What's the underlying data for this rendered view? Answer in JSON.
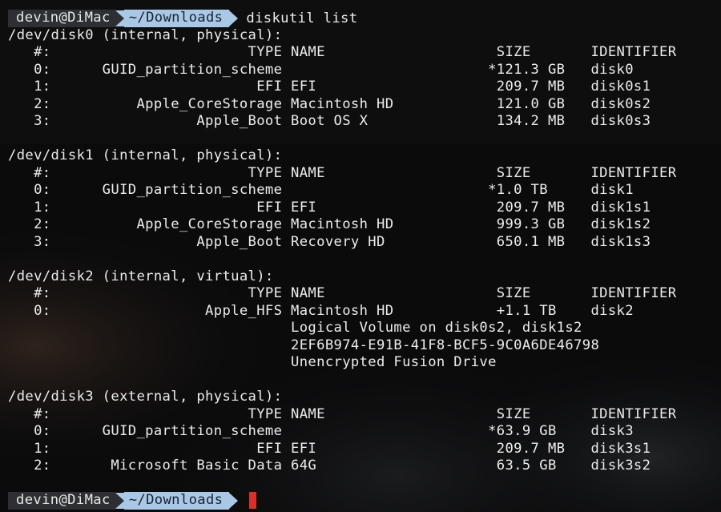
{
  "prompt": {
    "user": "devin@DiMac",
    "directory": "~/Downloads",
    "command": "diskutil list"
  },
  "output": [
    "/dev/disk0 (internal, physical):",
    "   #:                       TYPE NAME                    SIZE       IDENTIFIER",
    "   0:      GUID_partition_scheme                        *121.3 GB   disk0",
    "   1:                        EFI EFI                     209.7 MB   disk0s1",
    "   2:          Apple_CoreStorage Macintosh HD            121.0 GB   disk0s2",
    "   3:                 Apple_Boot Boot OS X               134.2 MB   disk0s3",
    "",
    "/dev/disk1 (internal, physical):",
    "   #:                       TYPE NAME                    SIZE       IDENTIFIER",
    "   0:      GUID_partition_scheme                        *1.0 TB     disk1",
    "   1:                        EFI EFI                     209.7 MB   disk1s1",
    "   2:          Apple_CoreStorage Macintosh HD            999.3 GB   disk1s2",
    "   3:                 Apple_Boot Recovery HD             650.1 MB   disk1s3",
    "",
    "/dev/disk2 (internal, virtual):",
    "   #:                       TYPE NAME                    SIZE       IDENTIFIER",
    "   0:                  Apple_HFS Macintosh HD            +1.1 TB    disk2",
    "                                 Logical Volume on disk0s2, disk1s2",
    "                                 2EF6B974-E91B-41F8-BCF5-9C0A6DE46798",
    "                                 Unencrypted Fusion Drive",
    "",
    "/dev/disk3 (external, physical):",
    "   #:                       TYPE NAME                    SIZE       IDENTIFIER",
    "   0:      GUID_partition_scheme                        *63.9 GB    disk3",
    "   1:                        EFI EFI                     209.7 MB   disk3s1",
    "   2:       Microsoft Basic Data 64G                     63.5 GB    disk3s2",
    ""
  ],
  "colors": {
    "background": "#0b0b0c",
    "text": "#ececec",
    "prompt_user_bg": "#2d2f33",
    "prompt_dir_bg": "#a9c8e6",
    "cursor": "#d9302b"
  }
}
